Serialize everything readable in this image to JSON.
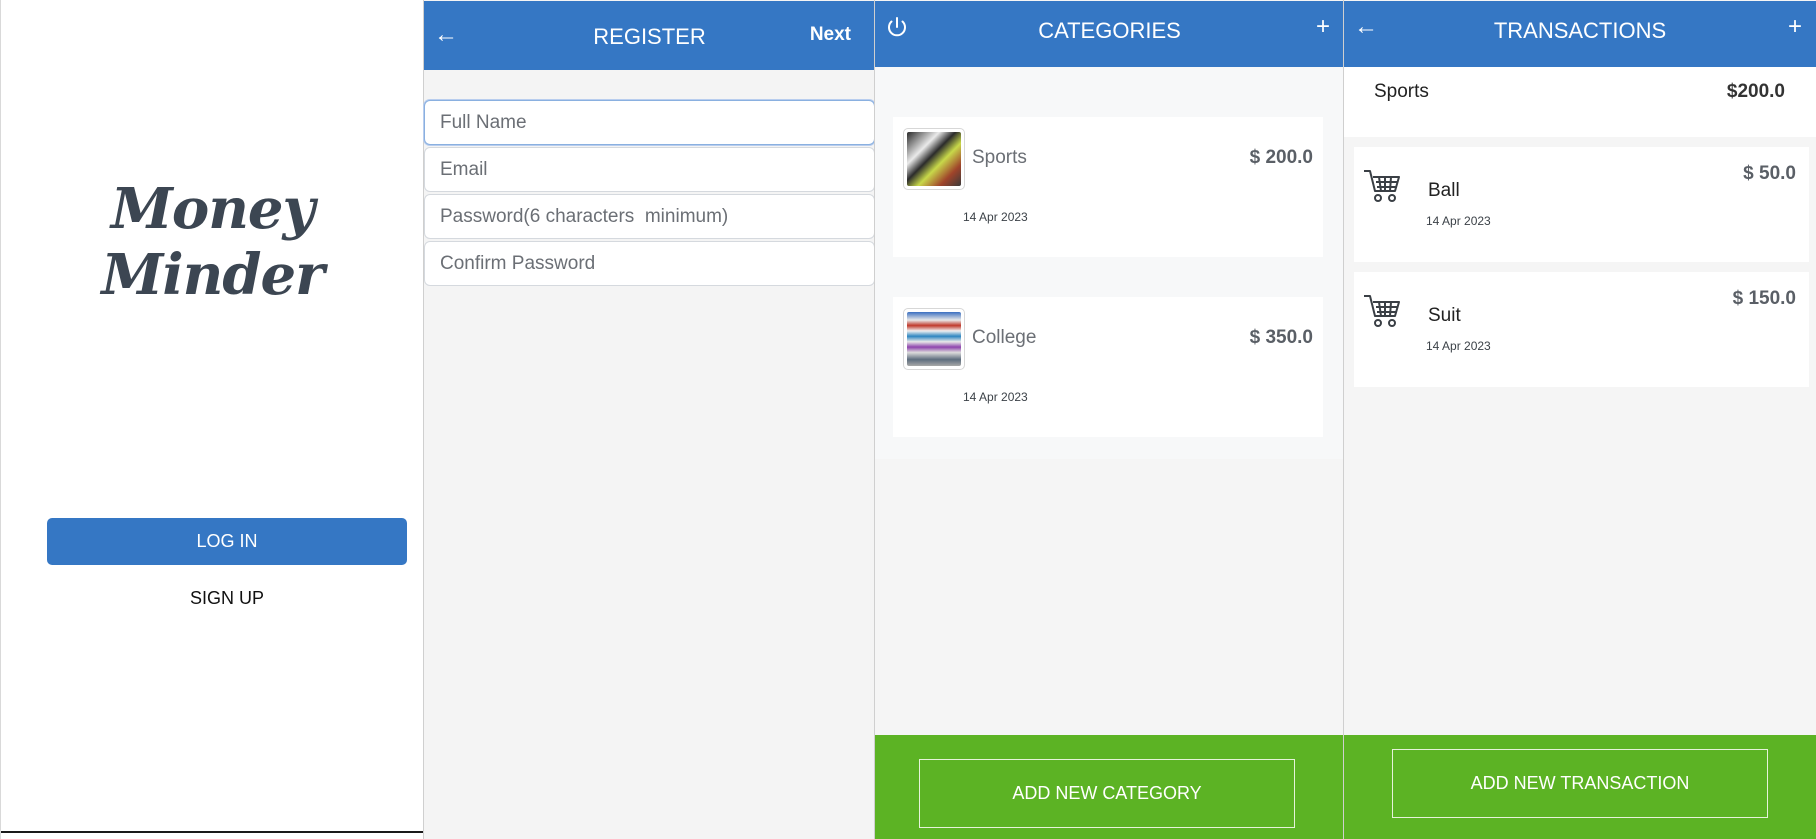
{
  "splash": {
    "logo": "Money Minder",
    "login_label": "LOG IN",
    "signup_label": "SIGN UP"
  },
  "register": {
    "back_icon": "back-arrow-icon",
    "title": "REGISTER",
    "next_label": "Next",
    "fields": [
      {
        "placeholder": "Full Name"
      },
      {
        "placeholder": "Email"
      },
      {
        "placeholder": "Password(6 characters  minimum)"
      },
      {
        "placeholder": "Confirm Password"
      }
    ]
  },
  "categories": {
    "power_icon": "power-icon",
    "title": "CATEGORIES",
    "add_icon": "plus-icon",
    "items": [
      {
        "name": "Sports",
        "amount": "$ 200.0",
        "date": "14 Apr 2023"
      },
      {
        "name": "College",
        "amount": "$ 350.0",
        "date": "14 Apr 2023"
      }
    ],
    "add_button": "ADD NEW CATEGORY"
  },
  "transactions": {
    "back_icon": "back-arrow-icon",
    "title": "TRANSACTIONS",
    "add_icon": "plus-icon",
    "category_name": "Sports",
    "category_total": "$200.0",
    "items": [
      {
        "name": "Ball",
        "amount": "$ 50.0",
        "date": "14 Apr 2023",
        "icon": "cart-icon"
      },
      {
        "name": "Suit",
        "amount": "$ 150.0",
        "date": "14 Apr 2023",
        "icon": "cart-icon"
      }
    ],
    "add_button": "ADD NEW TRANSACTION"
  },
  "colors": {
    "header_blue": "#3577c4",
    "footer_green": "#5cb324",
    "logo_text": "#3c4652"
  }
}
